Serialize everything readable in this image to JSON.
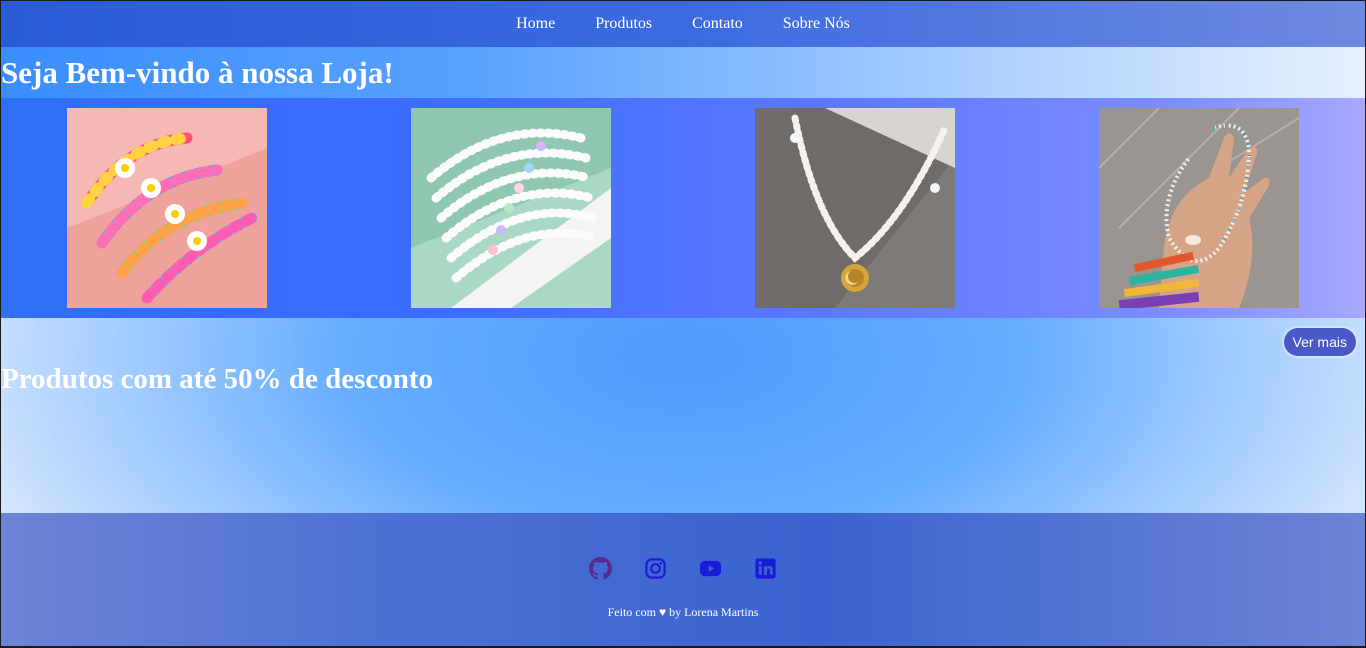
{
  "nav": {
    "items": [
      "Home",
      "Produtos",
      "Contato",
      "Sobre Nós"
    ]
  },
  "welcome": {
    "title": "Seja Bem-vindo à nossa Loja!"
  },
  "gallery": {
    "items": [
      {
        "name": "daisy-bead-bracelets"
      },
      {
        "name": "pearl-pastel-bracelets"
      },
      {
        "name": "pearl-moon-necklace"
      },
      {
        "name": "shell-bead-necklace"
      }
    ]
  },
  "actions": {
    "see_more_label": "Ver mais"
  },
  "promo": {
    "title": "Produtos com até 50% de desconto"
  },
  "footer": {
    "social": [
      "github-icon",
      "instagram-icon",
      "youtube-icon",
      "linkedin-icon"
    ],
    "credit": "Feito com ♥ by Lorena Martins"
  },
  "colors": {
    "nav_bg": "#3b6ae0",
    "button_bg": "#4a58c8",
    "footer_bg": "#4b6fd4",
    "icon_github": "#5b2a8c",
    "icon_blue": "#1a1adb"
  }
}
